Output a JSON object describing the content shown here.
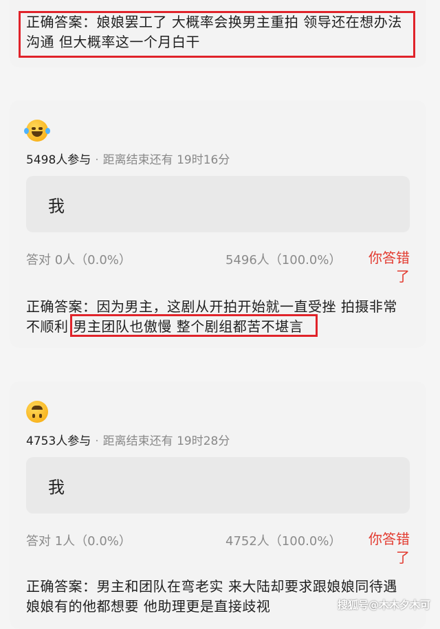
{
  "cards": [
    {
      "answer_line1": "正确答案：娘娘罢工了 大概率会换男主重拍 领导还在想办法",
      "answer_line2": "沟通 但大概率这一个月白干"
    },
    {
      "emoji": "laughing-tears-emoji",
      "participants": "5498人参与",
      "dot": "·",
      "countdown": "距离结束还有 19时16分",
      "option": "我",
      "correct_stat": "答对  0人（0.0%）",
      "wrong_stat": "5496人（100.0%）",
      "result": "你答错了",
      "answer_line1": "正确答案：因为男主，这剧从开拍开始就一直受挫 拍摄非常",
      "answer_line2_a": "不顺利 ",
      "answer_line2_b": "男主团队也傲慢 整个剧组都苦不堪言"
    },
    {
      "emoji": "upside-down-face-emoji",
      "participants": "4753人参与",
      "dot": "·",
      "countdown": "距离结束还有 19时28分",
      "option": "我",
      "correct_stat": "答对  1人（0.0%）",
      "wrong_stat": "4752人（100.0%）",
      "result": "你答错了",
      "answer_line1": "正确答案：男主和团队在弯老实 来大陆却要求跟娘娘同待遇",
      "answer_line2": "娘娘有的他都想要 他助理更是直接歧视"
    }
  ],
  "watermark": "搜狐号@木木夕木可",
  "colors": {
    "highlight": "#e0232a",
    "wrong": "#e23a2f"
  }
}
